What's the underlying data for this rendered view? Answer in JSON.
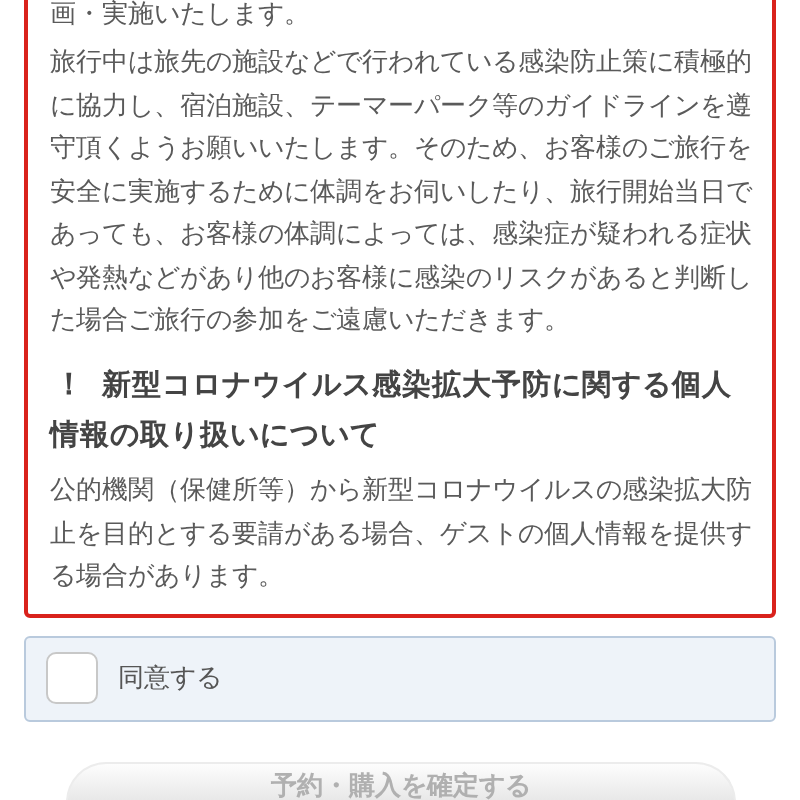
{
  "notice": {
    "paragraphs": [
      "画・実施いたします。",
      "旅行中は旅先の施設などで行われている感染防止策に積極的に協力し、宿泊施設、テーマーパーク等のガイドラインを遵守頂くようお願いいたします。そのため、お客様のご旅行を安全に実施するために体調をお伺いしたり、旅行開始当日であっても、お客様の体調によっては、感染症が疑われる症状や発熱などがあり他のお客様に感染のリスクがあると判断した場合ご旅行の参加をご遠慮いただきます。"
    ],
    "section": {
      "mark": "！",
      "heading": "新型コロナウイルス感染拡大予防に関する個人情報の取り扱いについて",
      "body": "公的機関（保健所等）から新型コロナウイルスの感染拡大防止を目的とする要請がある場合、ゲストの個人情報を提供する場合があります。"
    }
  },
  "agree": {
    "label": "同意する",
    "checked": false
  },
  "confirm_button": {
    "label": "予約・購入を確定する",
    "disabled": true
  }
}
